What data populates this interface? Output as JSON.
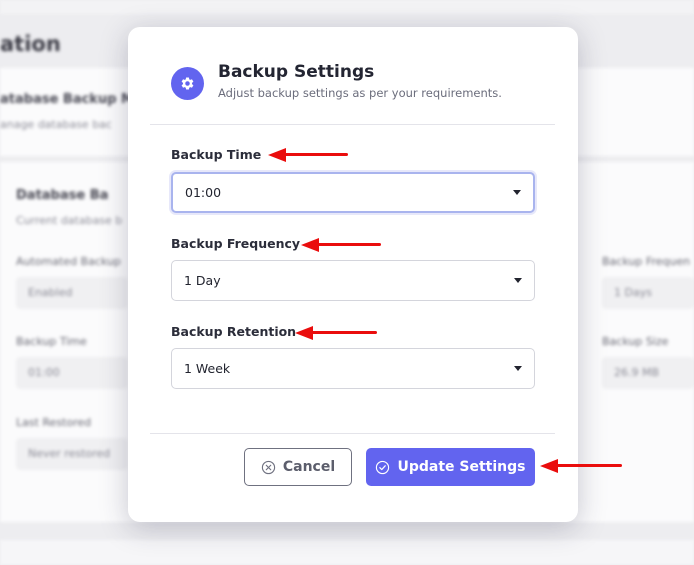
{
  "background": {
    "page_heading": "ation",
    "card1": {
      "title": "atabase Backup M",
      "subtitle": "anage database bac"
    },
    "card2": {
      "title": "Database Ba",
      "subtitle": "Current database b",
      "fields": [
        {
          "label": "Automated Backup",
          "value": "Enabled"
        },
        {
          "label": "Backup Time",
          "value": "01:00"
        },
        {
          "label": "Last Restored",
          "value": "Never restored"
        },
        {
          "label": "Backup Frequen",
          "value": "1 Days"
        },
        {
          "label": "Backup Size",
          "value": "26.9 MB"
        }
      ]
    }
  },
  "modal": {
    "title": "Backup Settings",
    "subtitle": "Adjust backup settings as per your requirements.",
    "icon": "gear-icon",
    "fields": {
      "backup_time": {
        "label": "Backup Time",
        "value": "01:00"
      },
      "backup_frequency": {
        "label": "Backup Frequency",
        "value": "1 Day"
      },
      "backup_retention": {
        "label": "Backup Retention",
        "value": "1 Week"
      }
    },
    "buttons": {
      "cancel": "Cancel",
      "update": "Update Settings"
    }
  },
  "colors": {
    "primary": "#6264ef",
    "annotation_arrow": "#ea0d0d"
  }
}
